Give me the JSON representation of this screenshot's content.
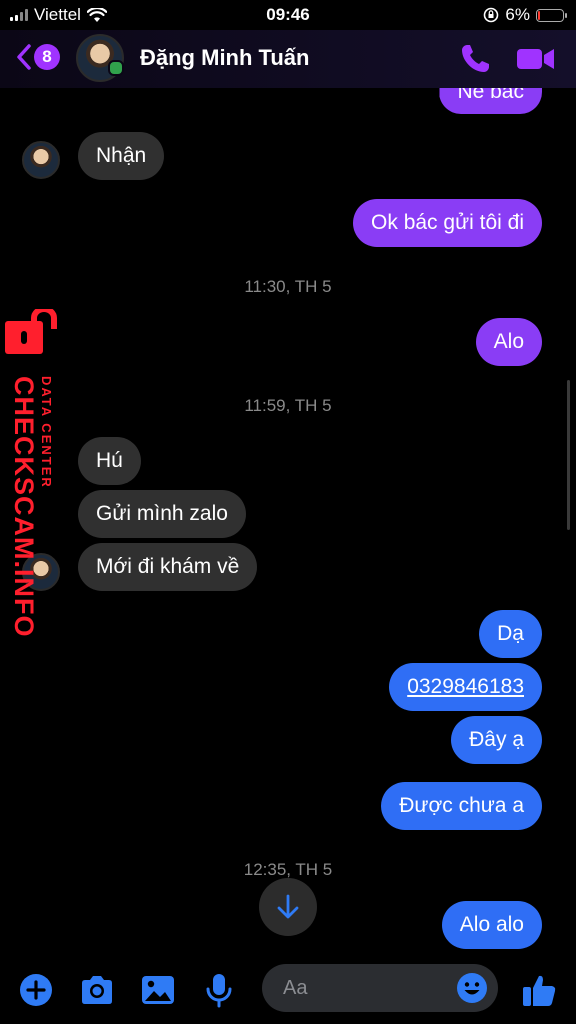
{
  "status_bar": {
    "carrier": "Viettel",
    "time": "09:46",
    "battery": "6%"
  },
  "header": {
    "unread_count": "8",
    "contact_name": "Đặng Minh Tuấn",
    "icons": [
      "back-chevron-icon",
      "phone-icon",
      "video-camera-icon"
    ],
    "accent_color": "#a033ff"
  },
  "messages": {
    "partial_top": "Nẻ bác",
    "m1": "Nhận",
    "m2": "Ok bác gửi tôi đi",
    "ts1": "11:30, TH 5",
    "m3": "Alo",
    "ts2": "11:59, TH 5",
    "m4": "Hú",
    "m5": "Gửi mình zalo",
    "m6": "Mới đi khám về",
    "m7": "Dạ",
    "m8": "0329846183",
    "m9": "Đây ạ",
    "m10": "Được chưa a",
    "ts3": "12:35, TH 5",
    "m11": "Alo alo"
  },
  "watermark": {
    "main": "CHECKSCAM.INFO",
    "sub": "DATA CENTER"
  },
  "composer": {
    "placeholder": "Aa",
    "icons": [
      "plus-icon",
      "camera-icon",
      "image-icon",
      "microphone-icon",
      "emoji-icon",
      "thumbs-up-icon"
    ],
    "icon_color": "#2f7bf5"
  },
  "colors": {
    "outgoing_purple": "#8a3df5",
    "outgoing_blue": "#2f6ef5",
    "incoming": "#303030"
  }
}
